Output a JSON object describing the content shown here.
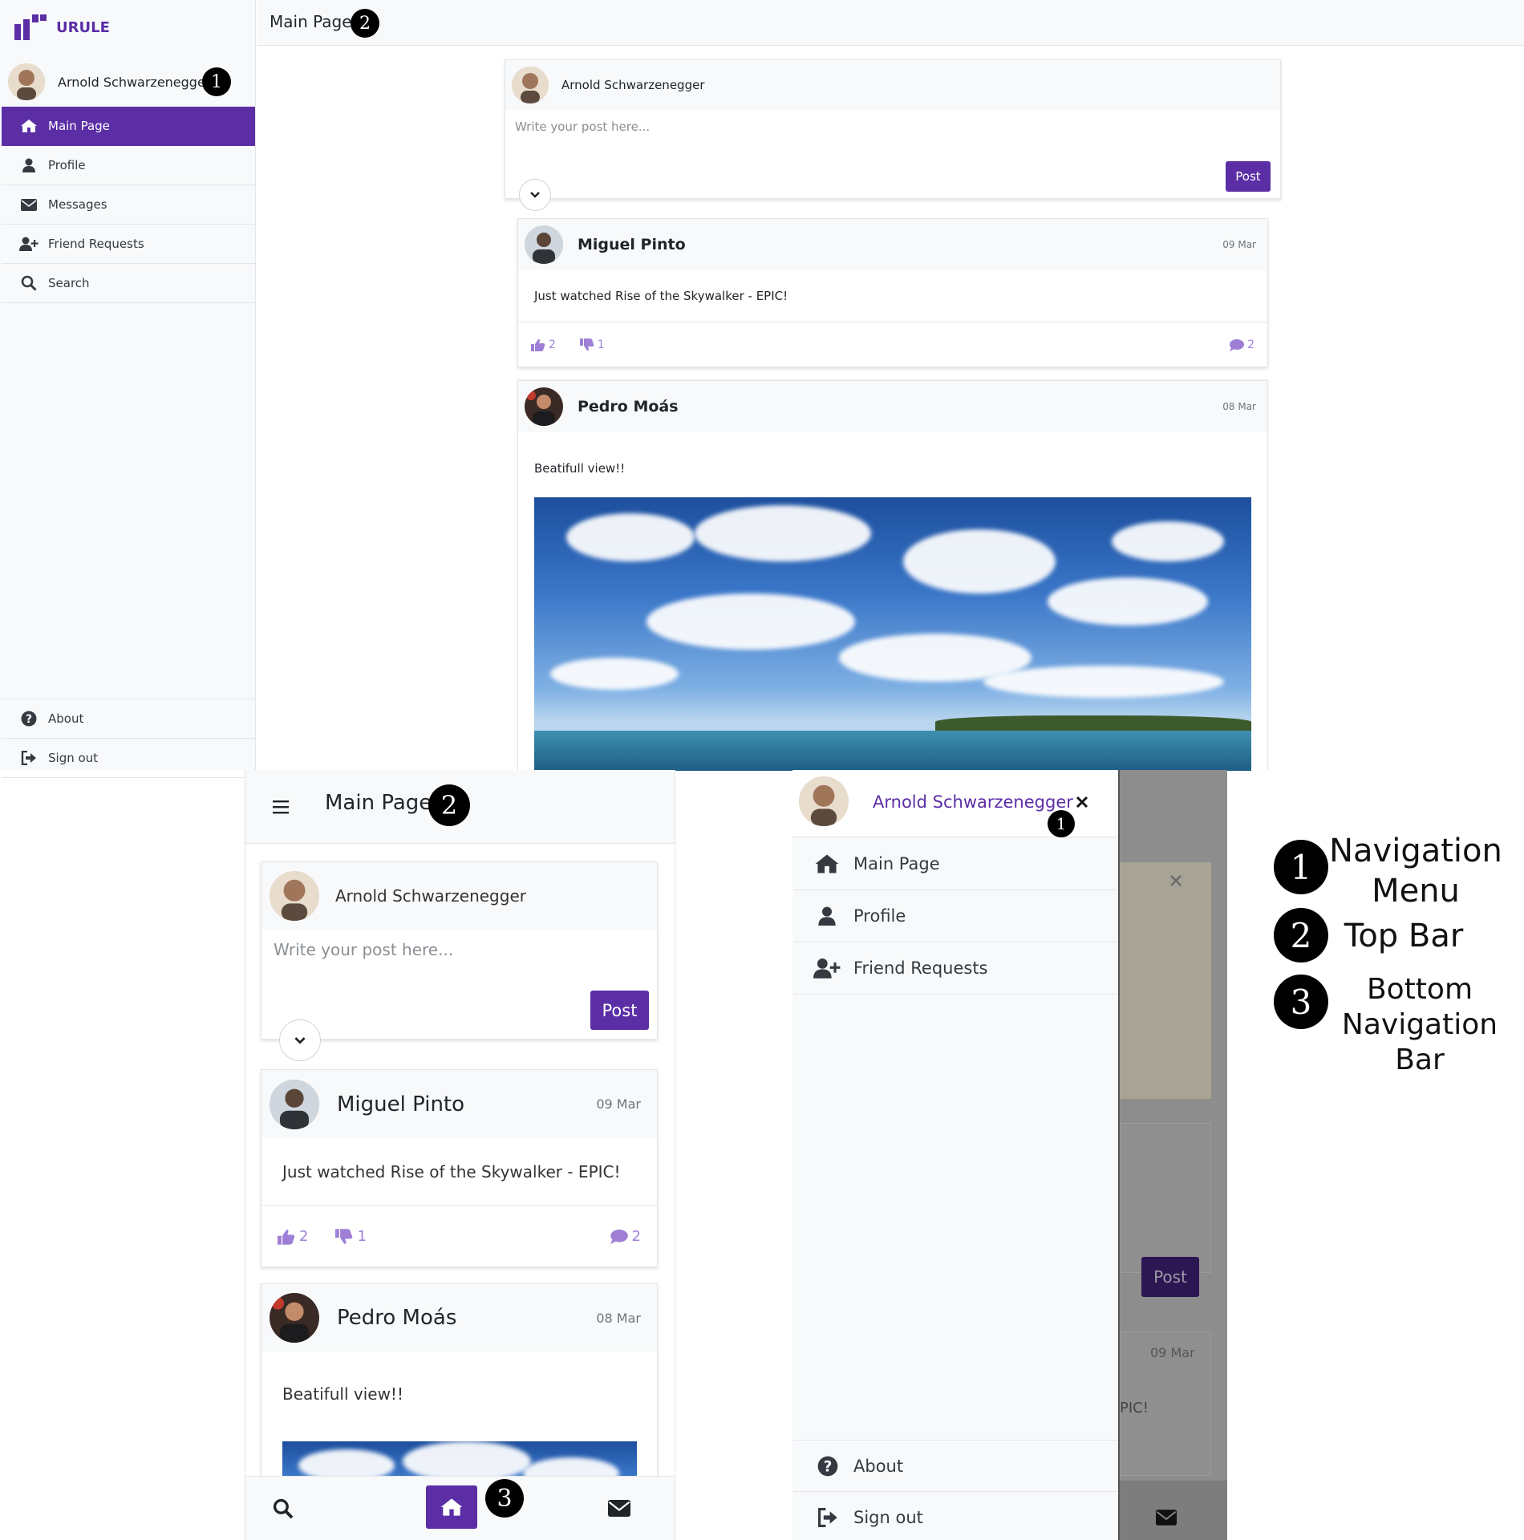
{
  "app": {
    "logo_text": "URULE",
    "brand_color": "#5b2ea6",
    "accent_light": "#9f7fd6"
  },
  "user": {
    "name": "Arnold Schwarzenegger"
  },
  "sidebar": {
    "items": [
      {
        "label": "Main Page",
        "icon": "home-icon",
        "active": true
      },
      {
        "label": "Profile",
        "icon": "user-icon"
      },
      {
        "label": "Messages",
        "icon": "envelope-icon"
      },
      {
        "label": "Friend Requests",
        "icon": "user-plus-icon"
      },
      {
        "label": "Search",
        "icon": "search-icon"
      }
    ],
    "bottom_items": [
      {
        "label": "About",
        "icon": "question-circle-icon"
      },
      {
        "label": "Sign out",
        "icon": "sign-out-icon"
      }
    ]
  },
  "topbar": {
    "title": "Main Page"
  },
  "composer": {
    "placeholder": "Write your post here...",
    "post_label": "Post"
  },
  "posts": [
    {
      "author": "Miguel Pinto",
      "date": "09 Mar",
      "text": "Just watched Rise of the Skywalker - EPIC!",
      "likes": "2",
      "dislikes": "1",
      "comments": "2"
    },
    {
      "author": "Pedro Moás",
      "date": "08 Mar",
      "text": "Beatifull view!!"
    }
  ],
  "mobile_drawer": {
    "items": [
      {
        "label": "Main Page",
        "icon": "home-icon"
      },
      {
        "label": "Profile",
        "icon": "user-icon"
      },
      {
        "label": "Friend Requests",
        "icon": "user-plus-icon"
      }
    ],
    "bottom_items": [
      {
        "label": "About",
        "icon": "question-circle-icon"
      },
      {
        "label": "Sign out",
        "icon": "sign-out-icon"
      }
    ],
    "background_post_label": "Post",
    "background_date": "09 Mar",
    "background_text_fragment": "PIC!"
  },
  "badges": {
    "one": "1",
    "two": "2",
    "three": "3"
  },
  "legend": [
    {
      "number": "1",
      "lines": [
        "Navigation",
        "Menu"
      ]
    },
    {
      "number": "2",
      "lines": [
        "Top Bar"
      ]
    },
    {
      "number": "3",
      "lines": [
        "Bottom",
        "Navigation Bar"
      ]
    }
  ]
}
